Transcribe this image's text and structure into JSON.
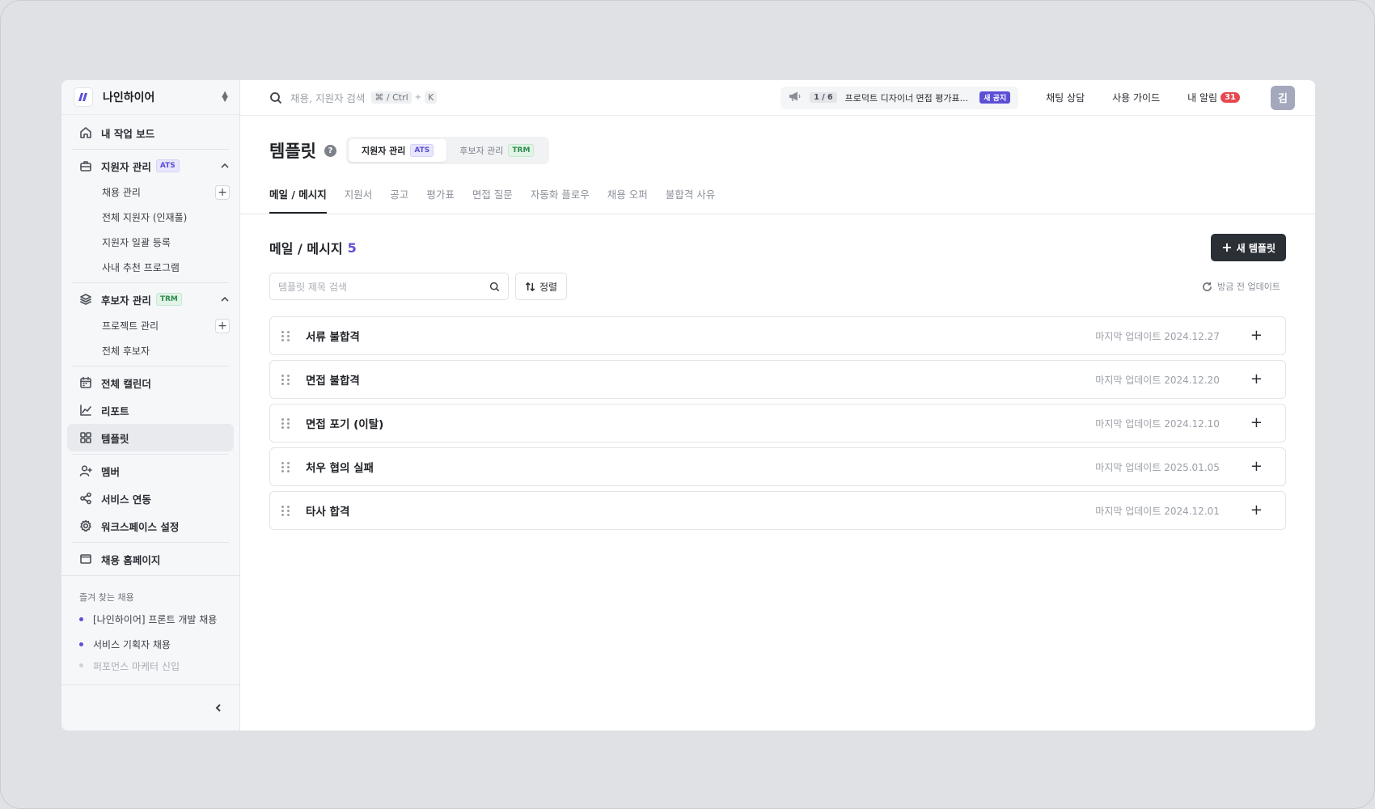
{
  "workspace": {
    "name": "나인하이어"
  },
  "sidebar": {
    "dashboard": "내 작업 보드",
    "ats": {
      "label": "지원자 관리",
      "badge": "ATS",
      "items": [
        "채용 관리",
        "전체 지원자 (인재풀)",
        "지원자 일괄 등록",
        "사내 추천 프로그램"
      ]
    },
    "trm": {
      "label": "후보자 관리",
      "badge": "TRM",
      "items": [
        "프로젝트 관리",
        "전체 후보자"
      ]
    },
    "calendar": "전체 캘린더",
    "report": "리포트",
    "template": "템플릿",
    "member": "멤버",
    "integration": "서비스 연동",
    "settings": "워크스페이스 설정",
    "homepage": "채용 홈페이지",
    "favorites_title": "즐겨 찾는 채용",
    "favorites": [
      "[나인하이어] 프론트 개발 채용",
      "서비스 기획자 채용",
      "퍼포먼스 마케터 신입"
    ]
  },
  "topbar": {
    "search_placeholder": "채용, 지원자 검색",
    "shortcut_mod": "⌘ / Ctrl",
    "shortcut_plus": "+",
    "shortcut_key": "K",
    "notice_page": "1 / 6",
    "notice_text": "프로덕트 디자이너 면접 평가표...",
    "notice_badge": "새 공지",
    "chat": "채팅 상담",
    "guide": "사용 가이드",
    "alarm": "내 알림",
    "alarm_count": "31",
    "avatar": "김"
  },
  "page": {
    "title": "템플릿",
    "help": "?",
    "segments": [
      {
        "label": "지원자 관리",
        "badge": "ATS"
      },
      {
        "label": "후보자 관리",
        "badge": "TRM"
      }
    ],
    "tabs": [
      "메일 / 메시지",
      "지원서",
      "공고",
      "평가표",
      "면접 질문",
      "자동화 플로우",
      "채용 오퍼",
      "불합격 사유"
    ],
    "section_title": "메일 / 메시지",
    "section_count": "5",
    "new_button": "새 템플릿",
    "search_placeholder": "템플릿 제목 검색",
    "sort_label": "정렬",
    "refresh_label": "방금 전 업데이트"
  },
  "templates": [
    {
      "name": "서류 불합격",
      "updated": "마지막 업데이트 2024.12.27"
    },
    {
      "name": "면접 불합격",
      "updated": "마지막 업데이트 2024.12.20"
    },
    {
      "name": "면접 포기 (이탈)",
      "updated": "마지막 업데이트 2024.12.10"
    },
    {
      "name": "처우 협의 실패",
      "updated": "마지막 업데이트 2025.01.05"
    },
    {
      "name": "타사 합격",
      "updated": "마지막 업데이트 2024.12.01"
    }
  ],
  "colors": {
    "accent": "#5b4fd6",
    "dark_button": "#2b2f36",
    "alarm": "#e5484d"
  }
}
